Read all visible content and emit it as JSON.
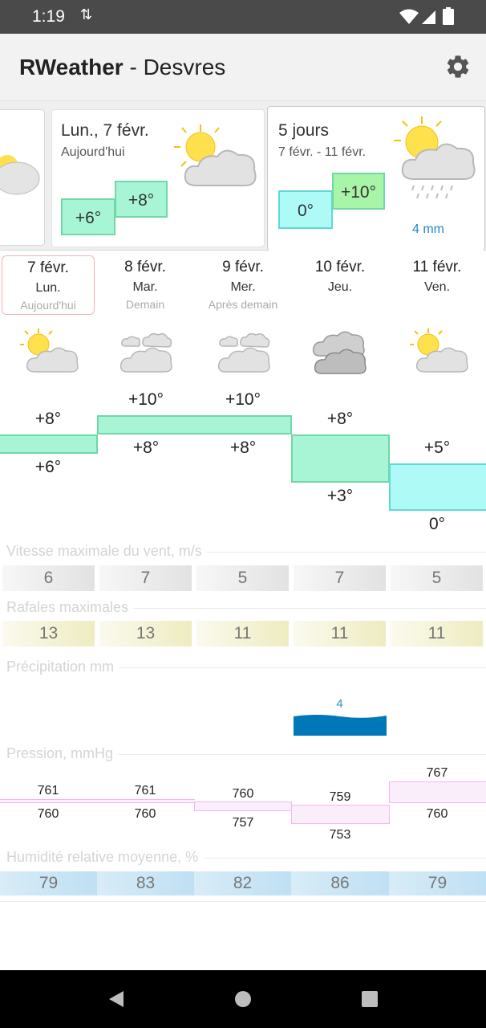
{
  "status": {
    "time": "1:19",
    "sync_glyph": "⇅"
  },
  "app": {
    "name": "RWeather",
    "separator": " - ",
    "location": "Desvres",
    "settings_icon": "gear-icon"
  },
  "cards": {
    "today": {
      "date": "Lun., 7 févr.",
      "sub": "Aujourd'hui",
      "low": "+6°",
      "high": "+8°",
      "icon": "partly-cloudy-icon"
    },
    "five_days": {
      "title": "5 jours",
      "range": "7 févr. - 11 févr.",
      "low": "0°",
      "high": "+10°",
      "precip": "4 mm",
      "icon": "sun-rain-cloud-icon"
    }
  },
  "days": [
    {
      "date": "7 févr.",
      "weekday": "Lun.",
      "note": "Aujourd'hui",
      "high": "+8°",
      "low": "+6°",
      "wind": "6",
      "gust": "13",
      "humidity": "79",
      "p_top": "761",
      "p_bottom": "760",
      "icon": "partly-cloudy-icon"
    },
    {
      "date": "8 févr.",
      "weekday": "Mar.",
      "note": "Demain",
      "high": "+10°",
      "low": "+8°",
      "wind": "7",
      "gust": "13",
      "humidity": "83",
      "p_top": "761",
      "p_bottom": "760",
      "icon": "cloudy-icon"
    },
    {
      "date": "9 févr.",
      "weekday": "Mer.",
      "note": "Après demain",
      "high": "+10°",
      "low": "+8°",
      "wind": "5",
      "gust": "11",
      "humidity": "82",
      "p_top": "760",
      "p_bottom": "757",
      "icon": "cloudy-icon"
    },
    {
      "date": "10 févr.",
      "weekday": "Jeu.",
      "note": "",
      "high": "+8°",
      "low": "+3°",
      "wind": "7",
      "gust": "11",
      "humidity": "86",
      "p_top": "759",
      "p_bottom": "753",
      "icon": "overcast-icon"
    },
    {
      "date": "11 févr.",
      "weekday": "Ven.",
      "note": "",
      "high": "+5°",
      "low": "0°",
      "wind": "5",
      "gust": "11",
      "humidity": "79",
      "p_top": "767",
      "p_bottom": "760",
      "icon": "partly-cloudy-icon"
    }
  ],
  "sections": {
    "wind": "Vitesse maximale du vent, m/s",
    "gusts": "Rafales maximales",
    "precip": "Précipitation mm",
    "pressure": "Pression, mmHg",
    "humidity": "Humidité relative moyenne, %"
  },
  "precip_value": "4",
  "colors": {
    "warm": "#a8f5d6",
    "warm_border": "#6fd8a8",
    "cold": "#adfaf7",
    "cold_border": "#5fd9d6",
    "precip": "#0077b8",
    "pressure_line": "#f3b6ef"
  },
  "nav": {
    "back_icon": "back-triangle-icon",
    "home_icon": "home-circle-icon",
    "recents_icon": "recents-square-icon"
  }
}
